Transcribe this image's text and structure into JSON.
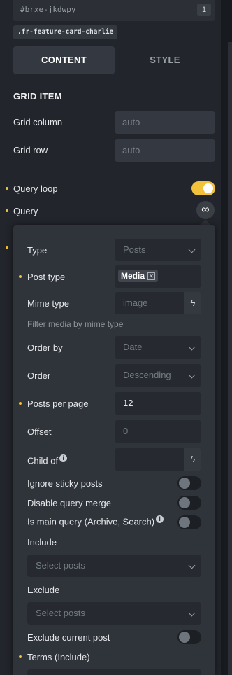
{
  "selector": {
    "id": "#brxe-jkdwpy",
    "count": "1",
    "class_name": ".fr-feature-card-charlie"
  },
  "tabs": {
    "content": "CONTENT",
    "style": "STYLE"
  },
  "grid_item": {
    "title": "GRID ITEM",
    "column_label": "Grid column",
    "column_placeholder": "auto",
    "row_label": "Grid row",
    "row_placeholder": "auto"
  },
  "query_loop": {
    "label": "Query loop",
    "enabled": true
  },
  "query": {
    "label": "Query",
    "icon": "infinity-icon"
  },
  "popup": {
    "type": {
      "label": "Type",
      "value": "Posts"
    },
    "post_type": {
      "label": "Post type",
      "chip": "Media"
    },
    "mime_type": {
      "label": "Mime type",
      "placeholder": "image"
    },
    "filter_link": "Filter media by mime type",
    "order_by": {
      "label": "Order by",
      "value": "Date"
    },
    "order": {
      "label": "Order",
      "value": "Descending"
    },
    "posts_per_page": {
      "label": "Posts per page",
      "value": "12"
    },
    "offset": {
      "label": "Offset",
      "placeholder": "0"
    },
    "child_of": {
      "label": "Child of"
    },
    "ignore_sticky": {
      "label": "Ignore sticky posts",
      "enabled": false
    },
    "disable_merge": {
      "label": "Disable query merge",
      "enabled": false
    },
    "is_main_query": {
      "label": "Is main query (Archive, Search)",
      "enabled": false
    },
    "include": {
      "label": "Include",
      "placeholder": "Select posts"
    },
    "exclude": {
      "label": "Exclude",
      "placeholder": "Select posts"
    },
    "exclude_current": {
      "label": "Exclude current post",
      "enabled": false
    },
    "terms_include": {
      "label": "Terms (Include)"
    }
  },
  "colors": {
    "accent": "#f2c23a",
    "panel": "#22252b",
    "popup": "#2f333a",
    "input": "#262a30"
  }
}
